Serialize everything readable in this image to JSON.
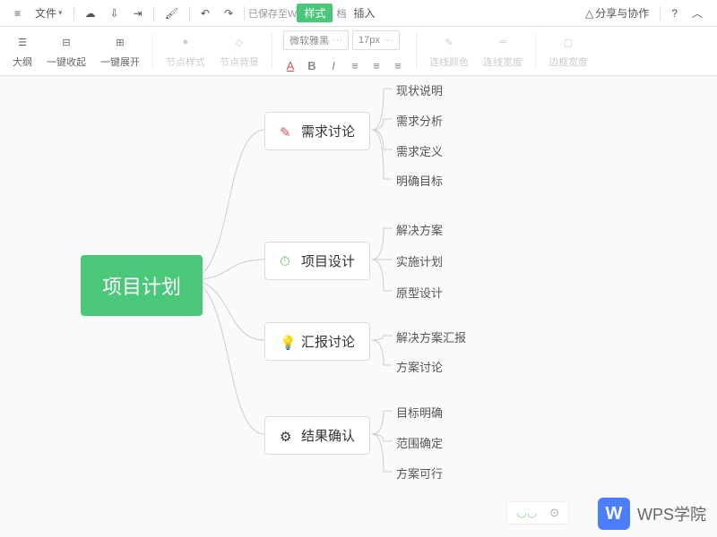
{
  "toolbar": {
    "file_label": "文件",
    "saved_text": "已保存至W",
    "style_btn": "样式",
    "insert_btn": "插入",
    "share_label": "分享与协作"
  },
  "ribbon": {
    "outline": "大纲",
    "collapse_all": "一键收起",
    "expand_all": "一键展开",
    "node_style": "节点样式",
    "node_bg": "节点背景",
    "font_name": "微软雅黑",
    "font_size": "17px",
    "line_color": "连线颜色",
    "line_width": "连线宽度",
    "border_width": "边框宽度"
  },
  "mindmap": {
    "root": "项目计划",
    "branches": [
      {
        "label": "需求讨论",
        "icon": "pencil",
        "color": "#d9534f",
        "children": [
          "现状说明",
          "需求分析",
          "需求定义",
          "明确目标"
        ]
      },
      {
        "label": "项目设计",
        "icon": "timer",
        "color": "#5cb85c",
        "children": [
          "解决方案",
          "实施计划",
          "原型设计"
        ]
      },
      {
        "label": "汇报讨论",
        "icon": "bulb",
        "color": "#f0ad4e",
        "children": [
          "解决方案汇报",
          "方案讨论"
        ]
      },
      {
        "label": "结果确认",
        "icon": "gear",
        "color": "#333",
        "children": [
          "目标明确",
          "范围确定",
          "方案可行"
        ]
      }
    ]
  },
  "watermark": {
    "badge": "W",
    "text": "WPS学院"
  }
}
